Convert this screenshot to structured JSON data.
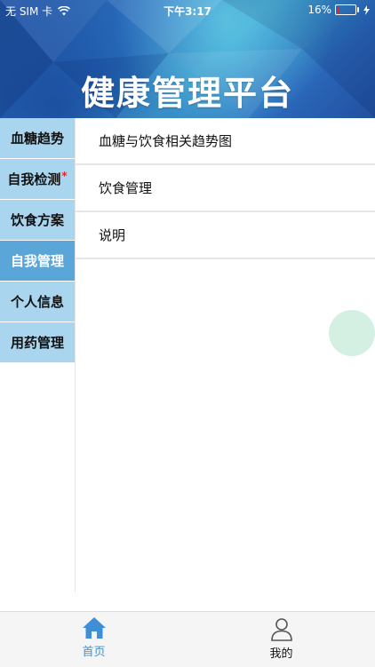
{
  "status_bar": {
    "carrier": "无 SIM 卡",
    "time": "下午3:17",
    "battery": "16%",
    "battery_level": 0.16,
    "icons": [
      "wifi-icon",
      "battery-icon",
      "charging-icon"
    ]
  },
  "header": {
    "title": "健康管理平台"
  },
  "sidebar": {
    "items": [
      {
        "label": "血糖趋势",
        "badge": ""
      },
      {
        "label": "自我检测",
        "badge": "*"
      },
      {
        "label": "饮食方案",
        "badge": ""
      },
      {
        "label": "自我管理",
        "badge": ""
      },
      {
        "label": "个人信息",
        "badge": ""
      },
      {
        "label": "用药管理",
        "badge": ""
      }
    ],
    "active_label": "自我管理"
  },
  "main": {
    "items": [
      {
        "label": "血糖与饮食相关趋势图"
      },
      {
        "label": "饮食管理"
      },
      {
        "label": "说明"
      }
    ]
  },
  "tabbar": {
    "tabs": [
      {
        "label": "首页",
        "icon": "home-icon"
      },
      {
        "label": "我的",
        "icon": "user-icon"
      }
    ],
    "active_color": "#3f8fd8"
  },
  "colors": {
    "sidebar_bg": "#a9d6ee",
    "sidebar_active": "#5aa6d9",
    "badge": "#e0262c"
  }
}
